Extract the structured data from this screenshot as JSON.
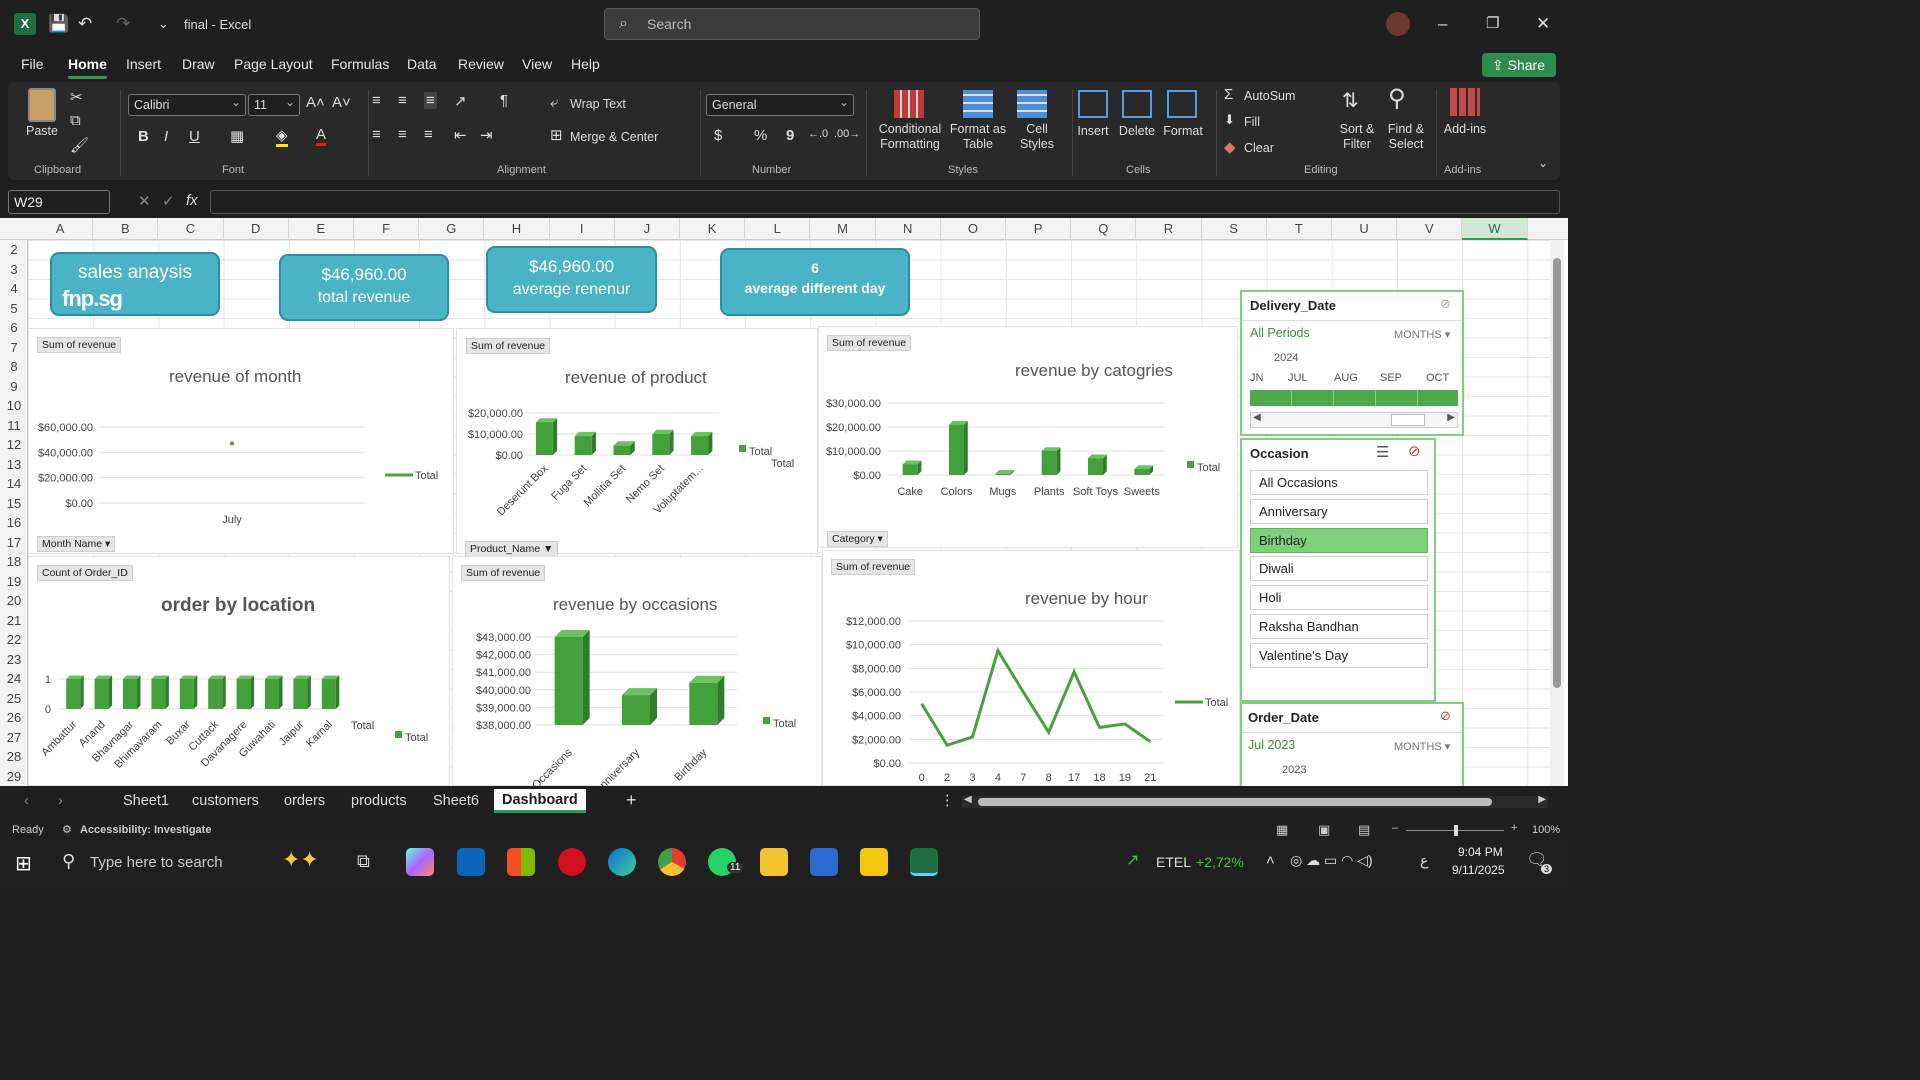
{
  "app": {
    "file_name": "final",
    "app_name": "Excel",
    "title_sep": "-"
  },
  "search": {
    "placeholder": "Search"
  },
  "menus": [
    "File",
    "Home",
    "Insert",
    "Draw",
    "Page Layout",
    "Formulas",
    "Data",
    "Review",
    "View",
    "Help"
  ],
  "share_label": "Share",
  "ribbon": {
    "clipboard": {
      "paste": "Paste",
      "label": "Clipboard"
    },
    "font": {
      "name": "Calibri",
      "size": "11",
      "label": "Font",
      "bold": "B",
      "italic": "I",
      "underline": "U"
    },
    "alignment": {
      "wrap": "Wrap Text",
      "merge": "Merge & Center",
      "label": "Alignment"
    },
    "number": {
      "format": "General",
      "label": "Number",
      "currency": "$",
      "percent": "%",
      "comma": "9"
    },
    "styles": {
      "conditional": "Conditional Formatting",
      "format_as": "Format as Table",
      "cell_styles": "Cell Styles",
      "label": "Styles"
    },
    "cells": {
      "insert": "Insert",
      "delete": "Delete",
      "format": "Format",
      "label": "Cells"
    },
    "editing": {
      "autosum": "AutoSum",
      "fill": "Fill",
      "clear": "Clear",
      "sort": "Sort & Filter",
      "find": "Find & Select",
      "label": "Editing"
    },
    "addins": {
      "addins": "Add-ins",
      "label": "Add-ins"
    }
  },
  "formula": {
    "name_box": "W29",
    "fx": "fx",
    "value": ""
  },
  "columns": [
    "A",
    "B",
    "C",
    "D",
    "E",
    "F",
    "G",
    "H",
    "I",
    "J",
    "K",
    "L",
    "M",
    "N",
    "O",
    "P",
    "Q",
    "R",
    "S",
    "T",
    "U",
    "V",
    "W"
  ],
  "rows": [
    "2",
    "3",
    "4",
    "5",
    "6",
    "7",
    "8",
    "9",
    "10",
    "11",
    "12",
    "13",
    "14",
    "15",
    "16",
    "17",
    "18",
    "19",
    "20",
    "21",
    "22",
    "23",
    "24",
    "25",
    "26",
    "27",
    "28",
    "29"
  ],
  "cards": {
    "sales": {
      "title": "sales anaysis",
      "logo": "fnp.sg"
    },
    "revenue": {
      "value": "$46,960.00",
      "label": "total revenue"
    },
    "avg": {
      "value": "$46,960.00",
      "label": "average renenur"
    },
    "days": {
      "value": "6",
      "label": "average different day"
    }
  },
  "charts": {
    "month": {
      "field": "Sum of revenue",
      "title": "revenue  of month",
      "filter": "Month Name",
      "legend": "Total"
    },
    "product": {
      "field": "Sum of revenue",
      "title": "revenue of product",
      "filter": "Product_Name",
      "legend": "Total"
    },
    "category": {
      "field": "Sum of revenue",
      "title": "revenue by catogries",
      "filter": "Category",
      "legend": "Total"
    },
    "location": {
      "field": "Count of Order_ID",
      "title": "order by location",
      "legend": "Total"
    },
    "occasion": {
      "field": "Sum of revenue",
      "title": "revenue by occasions",
      "legend": "Total"
    },
    "hour": {
      "field": "Sum of revenue",
      "title": "revenue by hour",
      "legend": "Total"
    }
  },
  "chart_data": [
    {
      "id": "month",
      "type": "line",
      "title": "revenue  of month",
      "categories": [
        "July"
      ],
      "series": [
        {
          "name": "Total",
          "values": [
            46960
          ]
        }
      ],
      "yticks": [
        "$60,000.00",
        "$40,000.00",
        "$20,000.00",
        "$0.00"
      ],
      "ylim": [
        0,
        60000
      ],
      "legend": "right"
    },
    {
      "id": "product",
      "type": "bar",
      "title": "revenue of product",
      "categories": [
        "Deserunt Box",
        "Fuga Set",
        "Mollitia Set",
        "Nemo Set",
        "Voluptatem..."
      ],
      "series": [
        {
          "name": "Total",
          "values": [
            15500,
            9000,
            4500,
            10000,
            9000
          ]
        }
      ],
      "yticks": [
        "$20,000.00",
        "$10,000.00",
        "$0.00"
      ],
      "ylim": [
        0,
        20000
      ],
      "legend": "right"
    },
    {
      "id": "category",
      "type": "bar",
      "title": "revenue by catogries",
      "categories": [
        "Cake",
        "Colors",
        "Mugs",
        "Plants",
        "Soft Toys",
        "Sweets"
      ],
      "series": [
        {
          "name": "Total",
          "values": [
            4500,
            21000,
            500,
            10000,
            7000,
            2500
          ]
        }
      ],
      "yticks": [
        "$30,000.00",
        "$20,000.00",
        "$10,000.00",
        "$0.00"
      ],
      "ylim": [
        0,
        30000
      ],
      "legend": "right"
    },
    {
      "id": "location",
      "type": "bar",
      "title": "order by location",
      "categories": [
        "Ambattur",
        "Anand",
        "Bhavnagar",
        "Bhimavaram",
        "Buxar",
        "Cuttack",
        "Davanagere",
        "Guwahati",
        "Jaipur",
        "Karnal"
      ],
      "series": [
        {
          "name": "Total",
          "values": [
            1,
            1,
            1,
            1,
            1,
            1,
            1,
            1,
            1,
            1
          ]
        }
      ],
      "yticks": [
        "1",
        "0"
      ],
      "ylim": [
        0,
        1
      ],
      "legend": "right"
    },
    {
      "id": "occasion",
      "type": "bar",
      "title": "revenue by occasions",
      "categories": [
        "All Occasions",
        "Anniversary",
        "Birthday"
      ],
      "series": [
        {
          "name": "Total",
          "values": [
            43000,
            39700,
            40400
          ]
        }
      ],
      "yticks": [
        "$43,000.00",
        "$42,000.00",
        "$41,000.00",
        "$40,000.00",
        "$39,000.00",
        "$38,000.00"
      ],
      "ylim": [
        38000,
        43000
      ],
      "legend": "right"
    },
    {
      "id": "hour",
      "type": "line",
      "title": "revenue by hour",
      "categories": [
        "0",
        "2",
        "3",
        "4",
        "7",
        "8",
        "17",
        "18",
        "19",
        "21"
      ],
      "series": [
        {
          "name": "Total",
          "values": [
            5000,
            1500,
            2200,
            9500,
            6000,
            2600,
            7700,
            3000,
            3300,
            1800
          ]
        }
      ],
      "yticks": [
        "$12,000.00",
        "$10,000.00",
        "$8,000.00",
        "$6,000.00",
        "$4,000.00",
        "$2,000.00",
        "$0.00"
      ],
      "ylim": [
        0,
        12000
      ],
      "legend": "right"
    }
  ],
  "slicers": {
    "delivery": {
      "title": "Delivery_Date",
      "period": "All Periods",
      "unit": "MONTHS",
      "year": "2024",
      "months": [
        "JN",
        "JUL",
        "AUG",
        "SEP",
        "OCT"
      ]
    },
    "occasion": {
      "title": "Occasion",
      "items": [
        "All Occasions",
        "Anniversary",
        "Birthday",
        "Diwali",
        "Holi",
        "Raksha Bandhan",
        "Valentine's Day"
      ],
      "selected": "Birthday"
    },
    "order": {
      "title": "Order_Date",
      "period": "Jul 2023",
      "unit": "MONTHS",
      "year": "2023"
    }
  },
  "tabs": [
    "Sheet1",
    "customers",
    "orders",
    "products",
    "Sheet6",
    "Dashboard"
  ],
  "active_tab": "Dashboard",
  "status": {
    "ready": "Ready",
    "accessibility": "Accessibility: Investigate",
    "zoom": "100%"
  },
  "taskbar": {
    "search": "Type here to search",
    "network": "ETEL",
    "change": "+2,72%",
    "time": "9:04 PM",
    "date": "9/11/2025",
    "whatsapp_badge": "11",
    "notif": "3"
  },
  "colors": {
    "teal": "#4ab4c6",
    "green": "#3f9a37",
    "excel": "#1d6f42"
  }
}
